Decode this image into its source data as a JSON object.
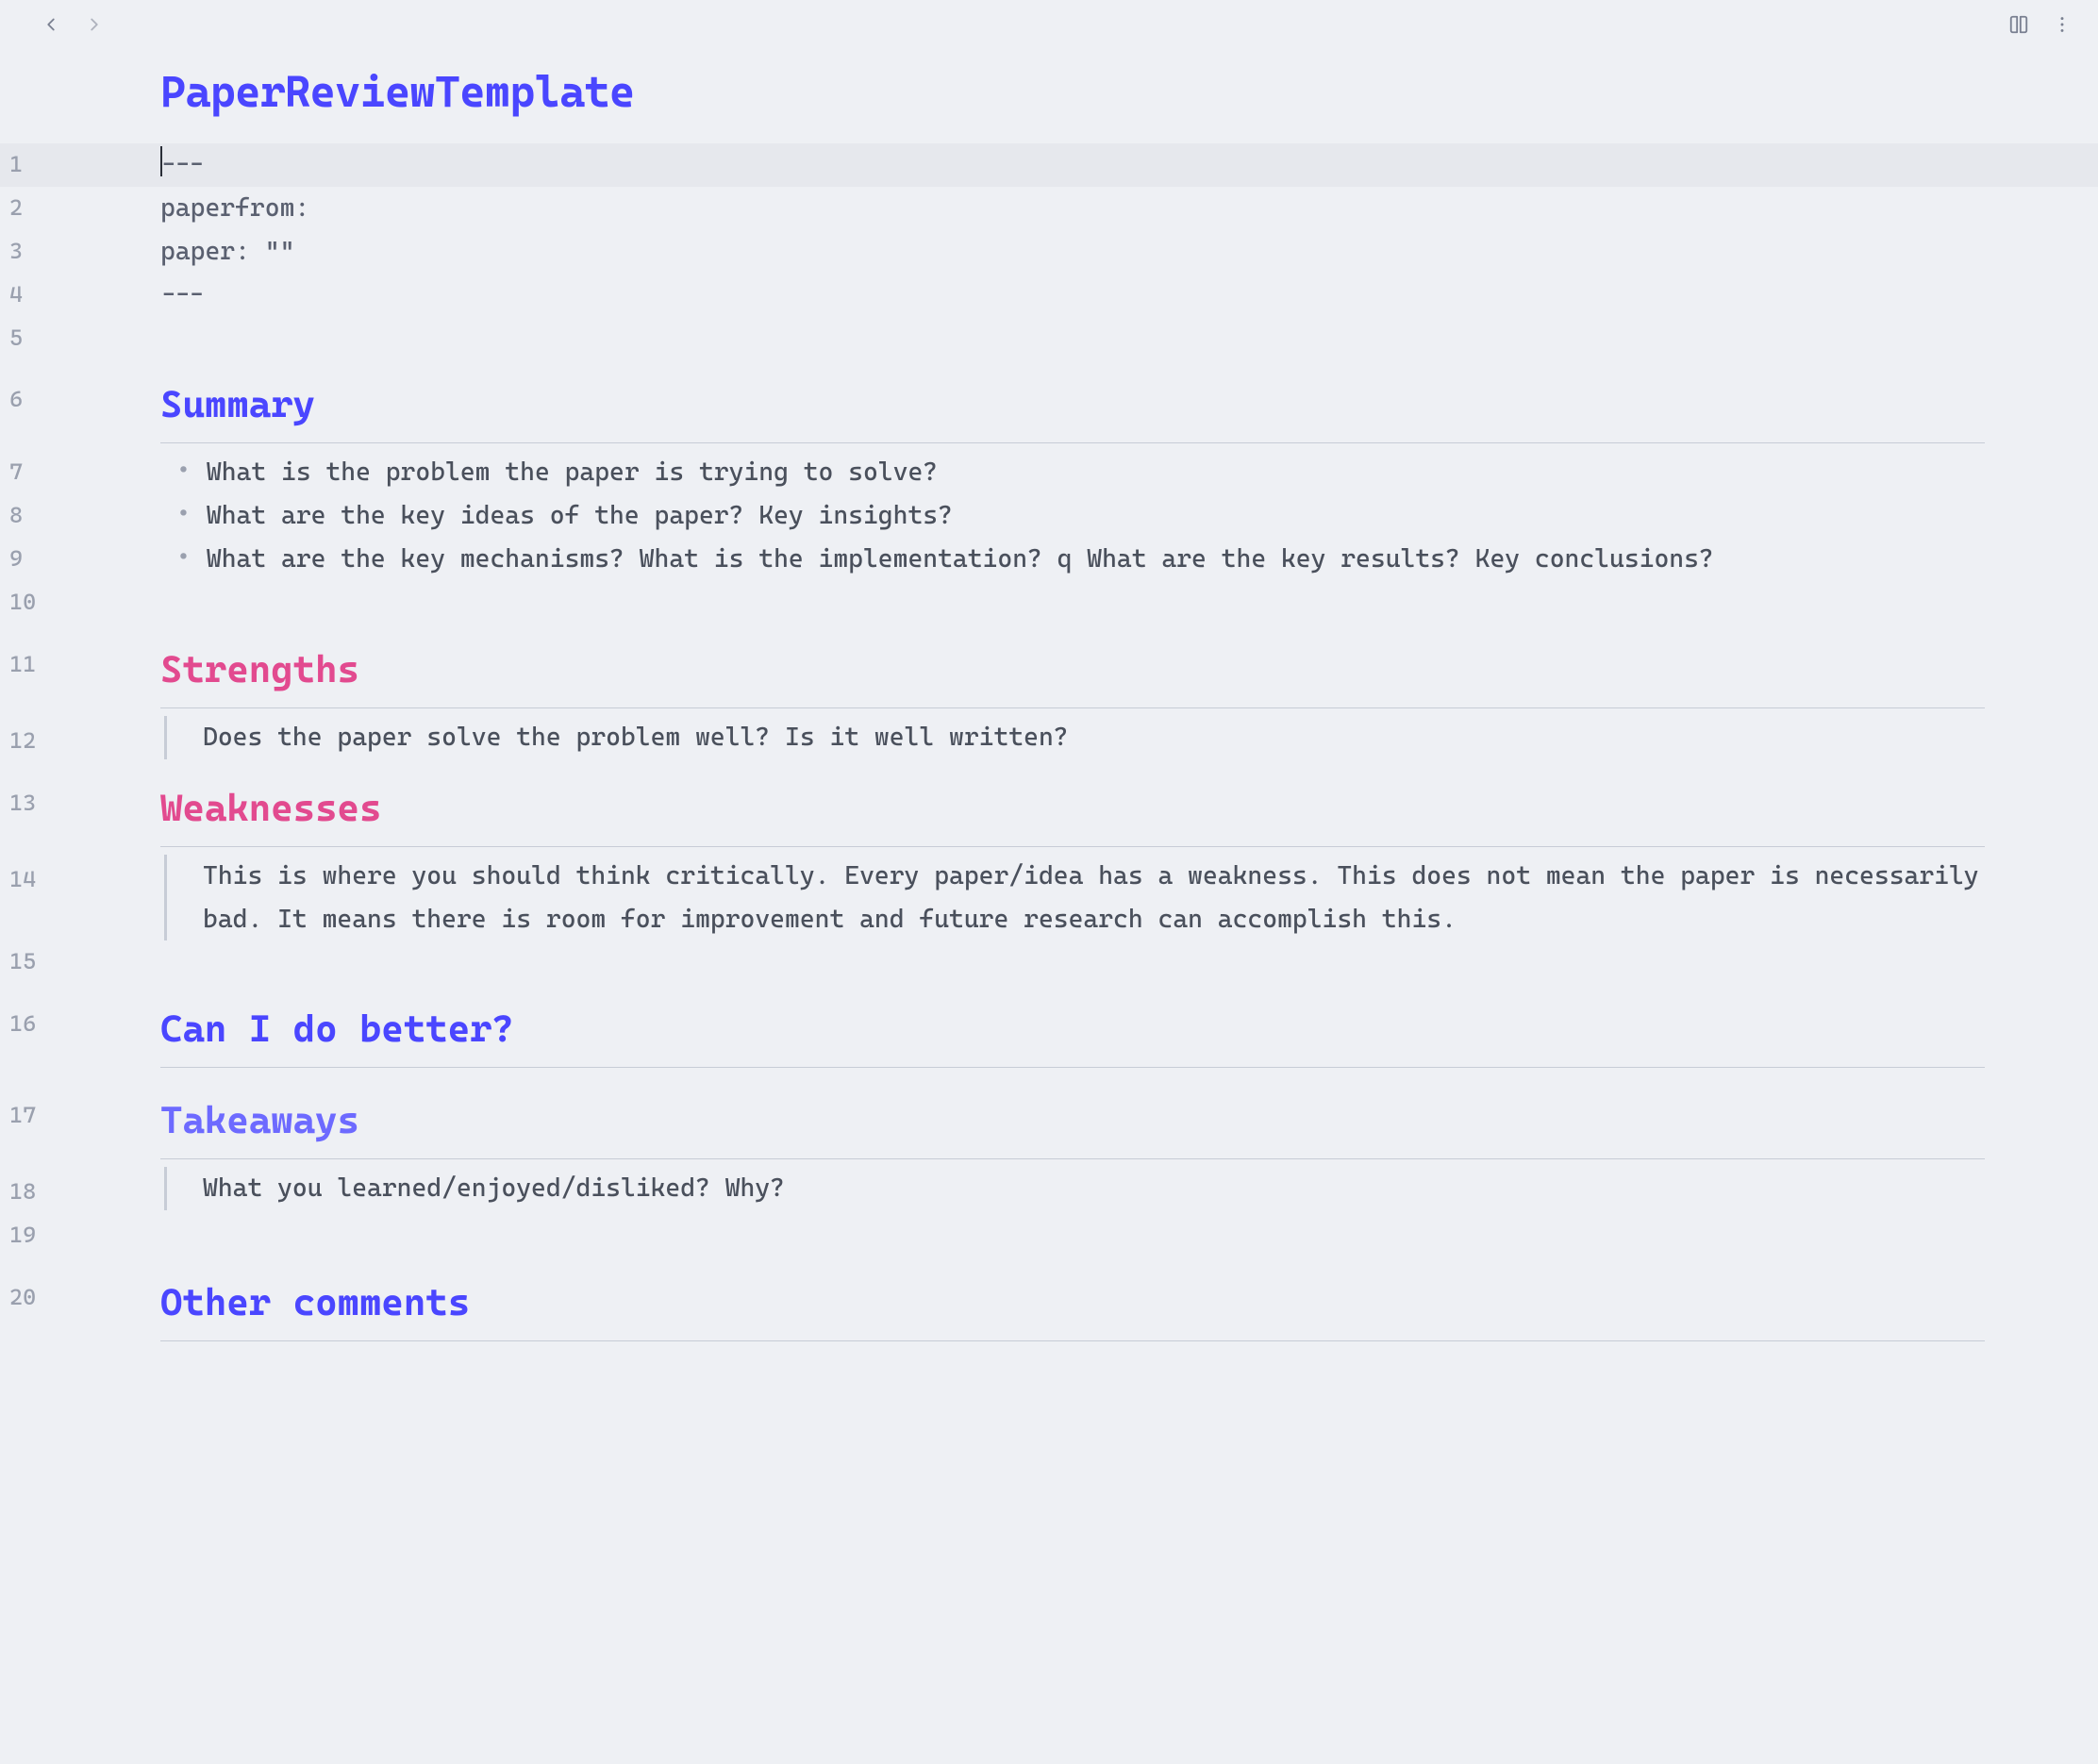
{
  "title": "PaperReviewTemplate",
  "frontmatter": {
    "open": "---",
    "l2": "paperfrom:",
    "l3": "paper: \"\"",
    "close": "---"
  },
  "sections": {
    "summary": {
      "heading": "Summary",
      "bullets": [
        "What is the problem the paper is trying to solve?",
        "What are the key ideas of the paper? Key insights?",
        "What are the key mechanisms? What is the implementation? q What are the key results? Key conclusions?"
      ]
    },
    "strengths": {
      "heading": "Strengths",
      "quote": "Does the paper solve the problem well? Is it well written?"
    },
    "weaknesses": {
      "heading": "Weaknesses",
      "quote": "This is where you should think critically. Every paper/idea has a weakness. This does not mean the paper is necessarily bad. It means there is room for improvement and future research can accomplish this."
    },
    "better": {
      "heading": "Can I do better?"
    },
    "takeaways": {
      "heading": "Takeaways",
      "quote": "What you learned/enjoyed/disliked? Why?"
    },
    "other": {
      "heading": "Other comments"
    }
  },
  "gutter": [
    "1",
    "2",
    "3",
    "4",
    "5",
    "6",
    "7",
    "8",
    "9",
    "10",
    "11",
    "12",
    "13",
    "14",
    "15",
    "16",
    "17",
    "18",
    "19",
    "20"
  ]
}
